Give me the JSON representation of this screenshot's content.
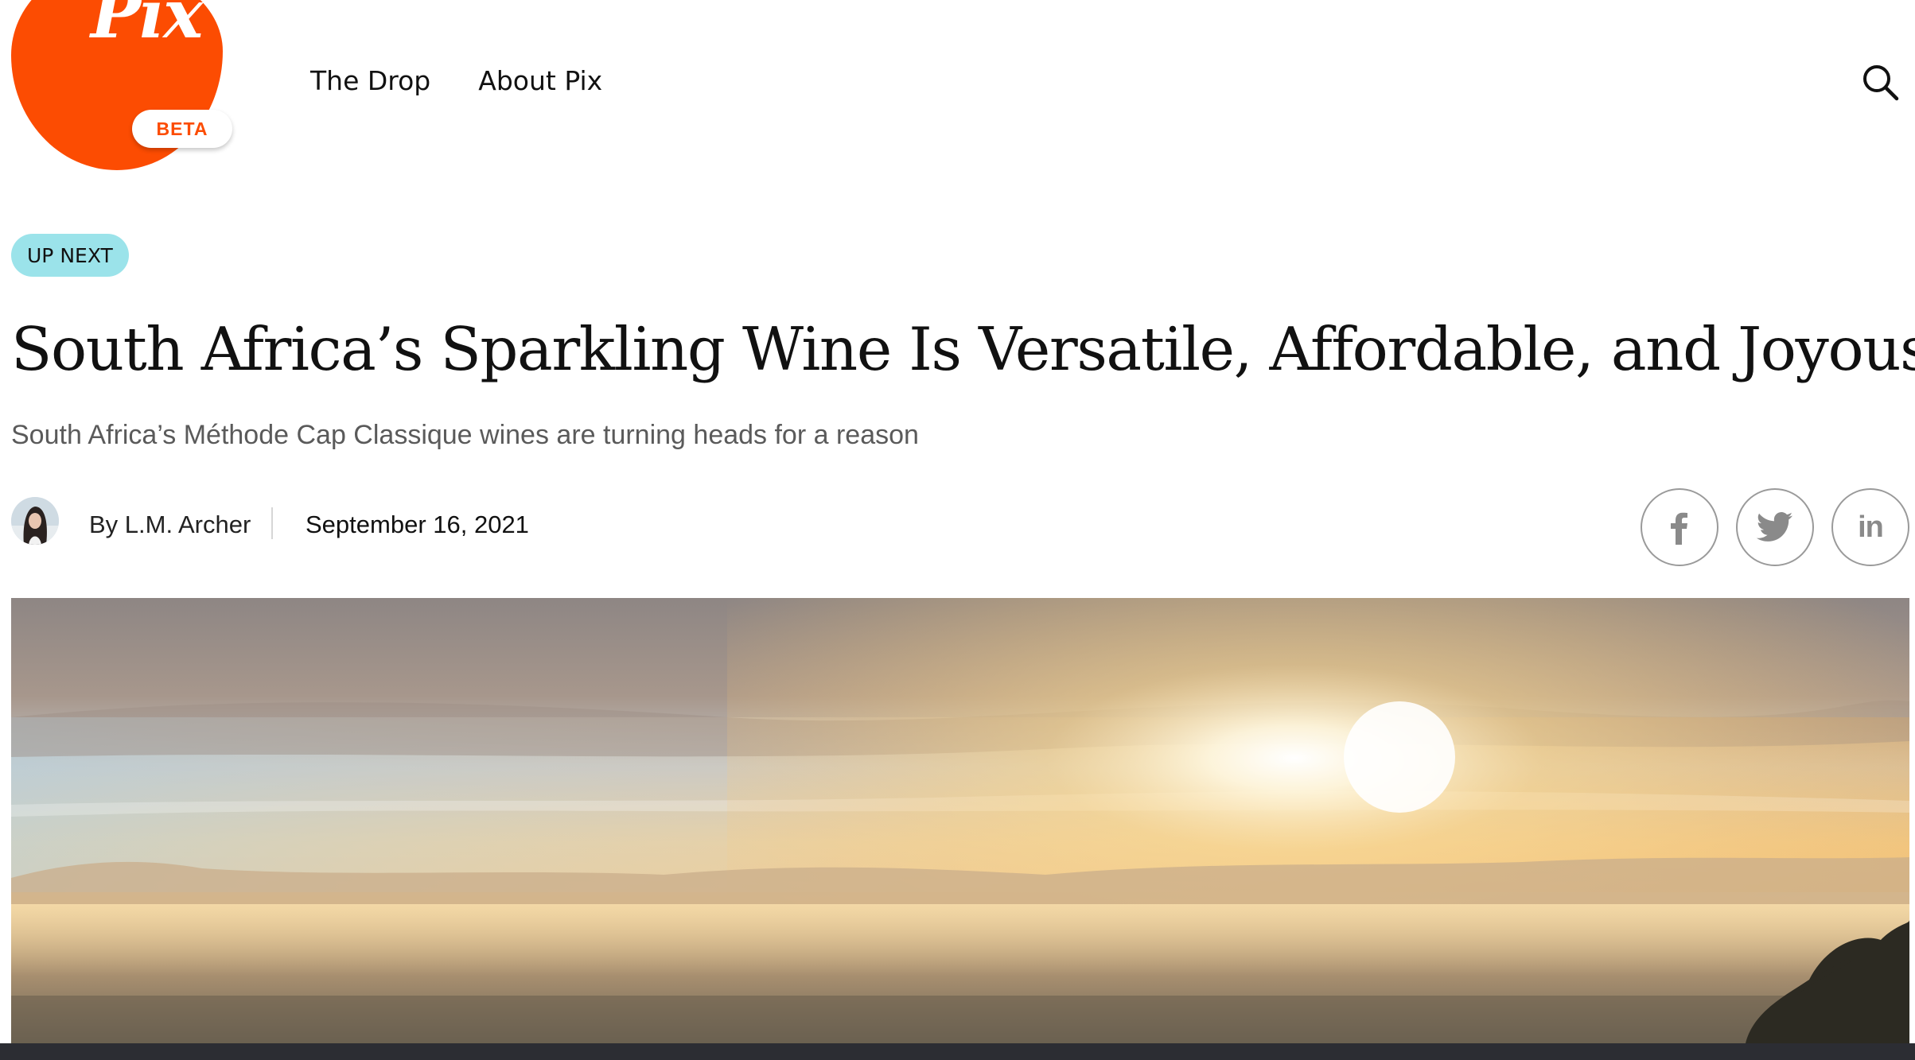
{
  "header": {
    "logo_text": "Pix",
    "logo_badge": "BETA",
    "nav": [
      "The Drop",
      "About Pix"
    ]
  },
  "article": {
    "label": "UP NEXT",
    "title": "South Africa’s Sparkling Wine Is Versatile, Affordable, and Joyous",
    "subtitle": "South Africa’s Méthode Cap Classique wines are turning heads for a reason",
    "author": "By L.M. Archer",
    "date": "September 16, 2021",
    "share": [
      "facebook",
      "twitter",
      "linkedin"
    ],
    "share_linkedin_text": "in"
  },
  "colors": {
    "brand": "#fc4c02",
    "badge": "#9be3ea",
    "share_icon": "#8a8a8a"
  },
  "icons": {
    "search": "search-icon",
    "facebook": "facebook-icon",
    "twitter": "twitter-icon",
    "linkedin": "linkedin-icon"
  }
}
